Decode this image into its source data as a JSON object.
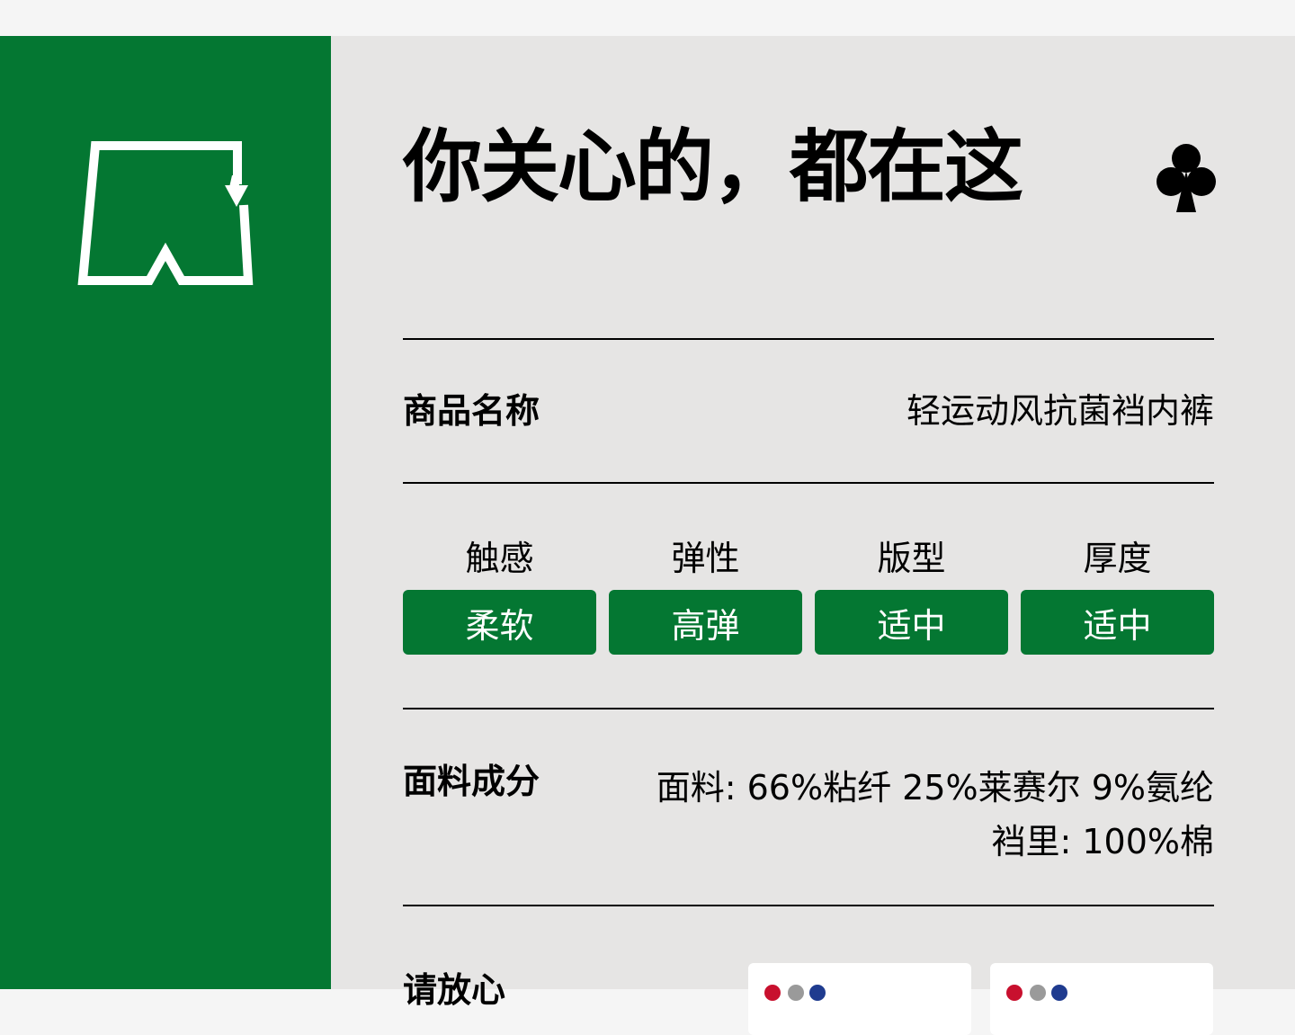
{
  "title": "你关心的，都在这",
  "product": {
    "label": "商品名称",
    "value": "轻运动风抗菌裆内裤"
  },
  "attributes": [
    {
      "label": "触感",
      "value": "柔软"
    },
    {
      "label": "弹性",
      "value": "高弹"
    },
    {
      "label": "版型",
      "value": "适中"
    },
    {
      "label": "厚度",
      "value": "适中"
    }
  ],
  "fabric": {
    "label": "面料成分",
    "lines": [
      "面料: 66%粘纤 25%莱赛尔 9%氨纶",
      "裆里: 100%棉"
    ]
  },
  "reassure": {
    "label": "请放心"
  },
  "icons": {
    "logo": "underwear-recycle-icon",
    "suit": "club-icon"
  },
  "colors": {
    "brand_green": "#047732",
    "panel_bg": "#e6e5e4",
    "text": "#000000",
    "pill_text": "#ffffff"
  }
}
